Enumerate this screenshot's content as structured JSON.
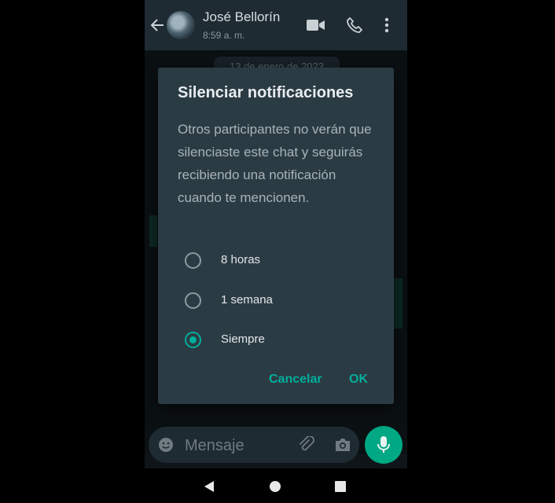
{
  "header": {
    "contact_name": "José Bellorín",
    "last_seen": "8:59 a. m."
  },
  "chat": {
    "date_chip": "13 de enero de 2023"
  },
  "dialog": {
    "title": "Silenciar notificaciones",
    "message": "Otros participantes no verán que silenciaste este chat y seguirás recibiendo una notificación cuando te mencionen.",
    "options": [
      {
        "label": "8 horas",
        "selected": false
      },
      {
        "label": "1 semana",
        "selected": false
      },
      {
        "label": "Siempre",
        "selected": true
      }
    ],
    "cancel_label": "Cancelar",
    "ok_label": "OK"
  },
  "input_bar": {
    "placeholder": "Mensaje"
  },
  "icons": {
    "back": "arrow-left-icon",
    "video": "video-camera-icon",
    "call": "phone-icon",
    "more": "more-vertical-icon",
    "emoji": "emoji-icon",
    "attach": "paperclip-icon",
    "camera": "camera-icon",
    "mic": "microphone-icon"
  },
  "colors": {
    "accent": "#00af9c",
    "dialog_bg": "#2b3b44",
    "header_bg": "#1f2b33",
    "mic_button": "#00a884"
  }
}
